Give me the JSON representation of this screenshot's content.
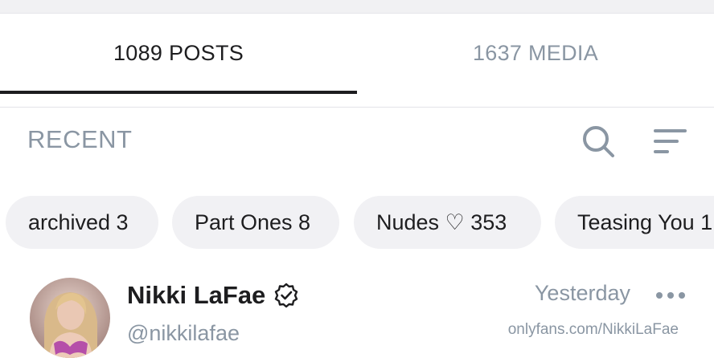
{
  "tabs": [
    {
      "label": "1089 POSTS",
      "active": true
    },
    {
      "label": "1637 MEDIA",
      "active": false
    }
  ],
  "sort": {
    "label": "RECENT"
  },
  "icons": {
    "search": "search-icon",
    "filter": "filter-lines-icon",
    "verified": "verified-badge-icon",
    "more": "more-dots-icon"
  },
  "chips": [
    {
      "label": "archived 3"
    },
    {
      "label": "Part Ones 8"
    },
    {
      "label": "Nudes ♡ 353"
    },
    {
      "label": "Teasing You 1"
    }
  ],
  "post": {
    "name": "Nikki LaFae",
    "handle": "@nikkilafae",
    "time": "Yesterday",
    "watermark": "onlyfans.com/NikkiLaFae"
  },
  "colors": {
    "accent": "#1d1d1f",
    "muted": "#8a96a3",
    "chip_bg": "#f1f1f4"
  }
}
